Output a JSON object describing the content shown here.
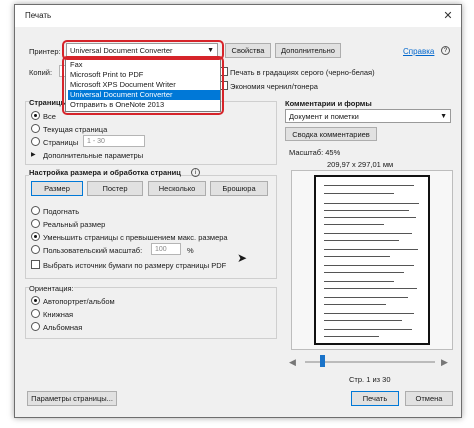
{
  "window": {
    "title": "Печать",
    "close_glyph": "✕"
  },
  "printer": {
    "label": "Принтер:",
    "selected": "Universal Document Converter",
    "properties_button": "Свойства",
    "advanced_button": "Дополнительно",
    "help_link": "Справка",
    "dropdown_options": [
      "Fax",
      "Microsoft Print to PDF",
      "Microsoft XPS Document Writer",
      "Universal Document Converter",
      "Отправить в OneNote 2013"
    ],
    "selected_index": 3
  },
  "copies": {
    "label": "Копий:"
  },
  "options": {
    "grayscale": "Печать в градациях серого (черно-белая)",
    "save_ink": "Экономия чернил/тонера"
  },
  "pages": {
    "title": "Страницы",
    "all": "Все",
    "current": "Текущая страница",
    "range": "Страницы",
    "range_value": "1 - 30",
    "more": "Дополнительные параметры"
  },
  "sizing": {
    "title": "Настройка размера и обработка страниц",
    "info_glyph": "i",
    "size_button": "Размер",
    "poster_button": "Постер",
    "multiple_button": "Несколько",
    "booklet_button": "Брошюра",
    "fit": "Подогнать",
    "actual": "Реальный размер",
    "shrink": "Уменьшить страницы с превышением макс. размера",
    "custom_scale": "Пользовательский масштаб:",
    "scale_value": "100",
    "percent": "%",
    "paper_source": "Выбрать источник бумаги по размеру страницы PDF"
  },
  "orientation": {
    "title": "Ориентация:",
    "auto": "Автопортрет/альбом",
    "portrait": "Книжная",
    "landscape": "Альбомная"
  },
  "comments": {
    "title": "Комментарии и формы",
    "selected": "Документ и пометки",
    "summary_button": "Сводка комментариев"
  },
  "preview": {
    "scale_label": "Масштаб: 45%",
    "page_size": "209,97 x 297,01 мм",
    "prev_glyph": "◀",
    "next_glyph": "▶",
    "page_counter": "Стр. 1 из 30"
  },
  "footer": {
    "page_setup_button": "Параметры страницы...",
    "print_button": "Печать",
    "cancel_button": "Отмена"
  },
  "colors": {
    "accent": "#0078d7",
    "highlight": "#d6242a",
    "link": "#0066cc"
  }
}
